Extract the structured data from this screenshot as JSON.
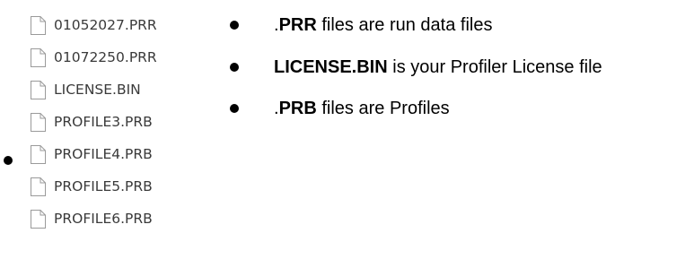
{
  "files": [
    {
      "name": "01052027.PRR",
      "icon": "file-icon"
    },
    {
      "name": "01072250.PRR",
      "icon": "file-icon"
    },
    {
      "name": "LICENSE.BIN",
      "icon": "file-icon"
    },
    {
      "name": "PROFILE3.PRB",
      "icon": "file-icon"
    },
    {
      "name": "PROFILE4.PRB",
      "icon": "file-icon"
    },
    {
      "name": "PROFILE5.PRB",
      "icon": "file-icon"
    },
    {
      "name": "PROFILE6.PRB",
      "icon": "file-icon"
    }
  ],
  "notes": [
    {
      "prefix": ".",
      "bold": "PRR",
      "rest": " files are run data files"
    },
    {
      "prefix": "",
      "bold": "LICENSE.BIN",
      "rest": " is your Profiler License file"
    },
    {
      "prefix": ".",
      "bold": "PRB",
      "rest": " files are Profiles"
    }
  ],
  "colors": {
    "text": "#000000",
    "file_text": "#3a3a3a",
    "icon_stroke": "#9a9a9a",
    "icon_fill": "#ffffff"
  }
}
